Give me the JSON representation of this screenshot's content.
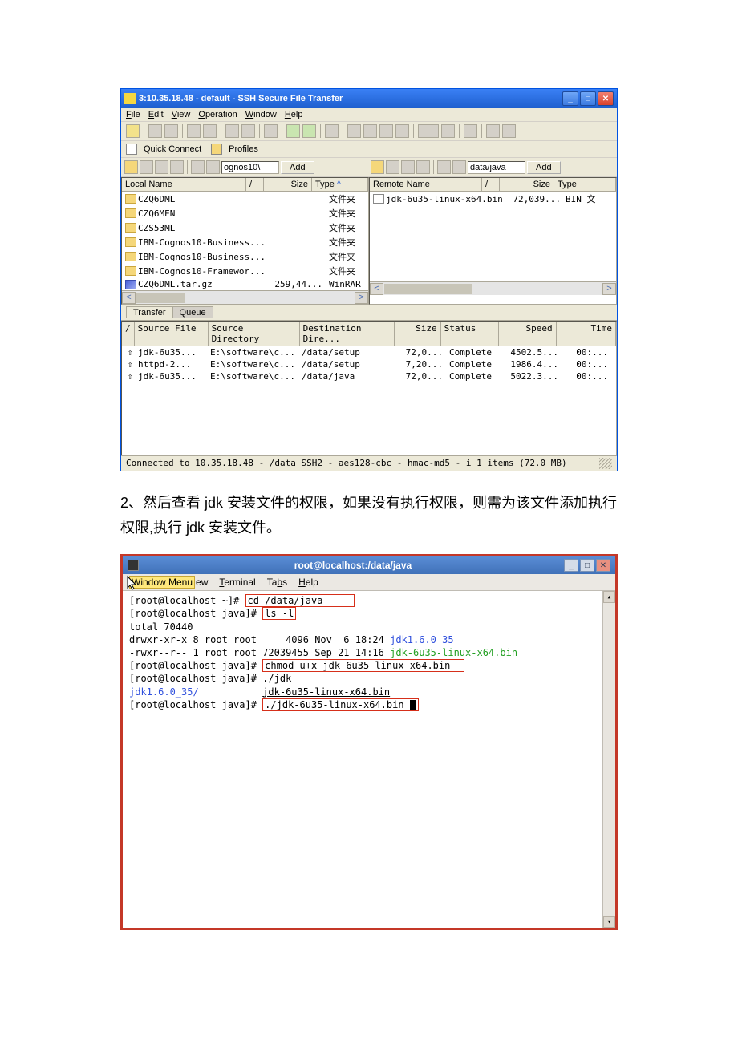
{
  "ssh": {
    "title": "3:10.35.18.48 - default - SSH Secure File Transfer",
    "menu": {
      "file": "File",
      "edit": "Edit",
      "view": "View",
      "operation": "Operation",
      "window": "Window",
      "help": "Help"
    },
    "quick": {
      "qc": "Quick Connect",
      "profiles": "Profiles"
    },
    "addL": "Add",
    "addR": "Add",
    "pathL": "ognos10\\",
    "pathR": "data/java",
    "localHead": {
      "name": "Local Name",
      "size": "Size",
      "type": "Type"
    },
    "remoteHead": {
      "name": "Remote Name",
      "size": "Size",
      "type": "Type"
    },
    "localFiles": [
      {
        "n": "CZQ6DML",
        "s": "",
        "t": "文件夹",
        "k": "folder"
      },
      {
        "n": "CZQ6MEN",
        "s": "",
        "t": "文件夹",
        "k": "folder"
      },
      {
        "n": "CZS53ML",
        "s": "",
        "t": "文件夹",
        "k": "folder"
      },
      {
        "n": "IBM-Cognos10-Business...",
        "s": "",
        "t": "文件夹",
        "k": "folder"
      },
      {
        "n": "IBM-Cognos10-Business...",
        "s": "",
        "t": "文件夹",
        "k": "folder"
      },
      {
        "n": "IBM-Cognos10-Framewor...",
        "s": "",
        "t": "文件夹",
        "k": "folder"
      },
      {
        "n": "CZQ6DML.tar.gz",
        "s": "259,44...",
        "t": "WinRAR",
        "k": "gz"
      }
    ],
    "remoteFiles": [
      {
        "n": "jdk-6u35-linux-x64.bin",
        "s": "72,039...",
        "t": "BIN 文",
        "k": "exe"
      }
    ],
    "tabs": {
      "transfer": "Transfer",
      "queue": "Queue"
    },
    "thead": {
      "src": "Source File",
      "dir": "Source Directory",
      "dest": "Destination Dire...",
      "size": "Size",
      "status": "Status",
      "speed": "Speed",
      "time": "Time"
    },
    "trows": [
      {
        "s": "jdk-6u35...",
        "d": "E:\\software\\c...",
        "de": "/data/setup",
        "sz": "72,0...",
        "st": "Complete",
        "sp": "4502.5...",
        "ti": "00:..."
      },
      {
        "s": "httpd-2...",
        "d": "E:\\software\\c...",
        "de": "/data/setup",
        "sz": "7,20...",
        "st": "Complete",
        "sp": "1986.4...",
        "ti": "00:..."
      },
      {
        "s": "jdk-6u35...",
        "d": "E:\\software\\c...",
        "de": "/data/java",
        "sz": "72,0...",
        "st": "Complete",
        "sp": "5022.3...",
        "ti": "00:..."
      }
    ],
    "status": "Connected to 10.35.18.48 - /data SSH2 - aes128-cbc - hmac-md5 - i 1 items (72.0 MB)"
  },
  "body_text": "2、然后查看 jdk 安装文件的权限，如果没有执行权限，则需为该文件添加执行权限,执行 jdk 安装文件。",
  "term": {
    "title": "root@localhost:/data/java",
    "menu": {
      "wm": "Window Menu",
      "view": "ew",
      "terminal": "Terminal",
      "tabs": "Tabs",
      "help": "Help"
    },
    "lines": {
      "p1a": "[root@localhost ~]# ",
      "p1b": "cd /data/java",
      "p2a": "[root@localhost java]# ",
      "p2b": "ls -l",
      "p3": "total 70440",
      "p4a": "drwxr-xr-x 8 root root     4096 Nov  6 18:24 ",
      "p4b": "jdk1.6.0_35",
      "p5a": "-rwxr--r-- 1 root root 72039455 Sep 21 14:16 ",
      "p5b": "jdk-6u35-linux-x64.bin",
      "p6a": "[root@localhost java]# ",
      "p6b": "chmod u+x jdk-6u35-linux-x64.bin  ",
      "p7": "[root@localhost java]# ./jdk",
      "p8a": "jdk1.6.0_35/           ",
      "p8b": "jdk-6u35-linux-x64.bin",
      "p9a": "[root@localhost java]# ",
      "p9b": "./jdk-6u35-linux-x64.bin"
    }
  }
}
